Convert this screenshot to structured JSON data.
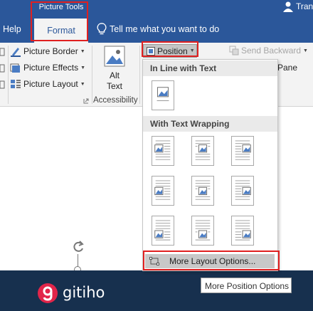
{
  "title_bar": {
    "contextual_group": "Picture Tools",
    "user_name": "Tran"
  },
  "tabs": {
    "help": "Help",
    "format": "Format"
  },
  "tell_me": {
    "text": "Tell me what you want to do"
  },
  "ribbon": {
    "picture_border": "Picture Border",
    "picture_effects": "Picture Effects",
    "picture_layout": "Picture Layout",
    "alt_text_line1": "Alt",
    "alt_text_line2": "Text",
    "accessibility_group": "Accessibility",
    "position": "Position",
    "send_backward": "Send Backward",
    "selection_pane": "Pane"
  },
  "position_menu": {
    "in_line_header": "In Line with Text",
    "wrapping_header": "With Text Wrapping",
    "more_options": "More Layout Options...",
    "tooltip": "More Position Options"
  },
  "logo": {
    "text": "gitiho"
  },
  "colors": {
    "ribbon_blue": "#2b579a",
    "highlight_red": "#e02020",
    "logo_red": "#e2254a",
    "banner_navy": "#17304e"
  }
}
